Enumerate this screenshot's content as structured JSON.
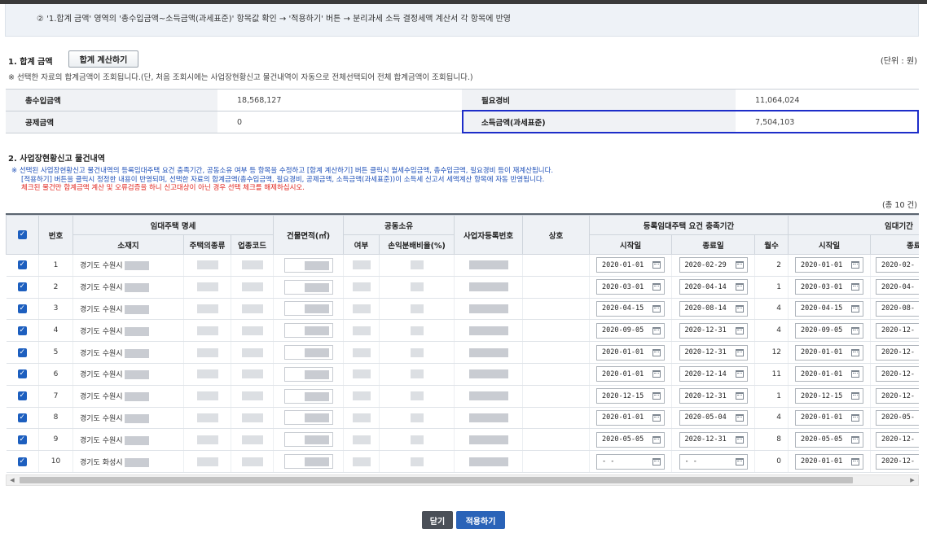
{
  "guide": {
    "text": "② '1.합계 금액' 영역의 '총수입금액~소득금액(과세표준)' 항목값 확인 → '적용하기' 버튼 → 분리과세 소득 결정세액 계산서 각 항목에 반영"
  },
  "section1": {
    "title": "1. 합계 금액",
    "calc_button": "합계 계산하기",
    "unit": "(단위 : 원)",
    "note": "※ 선택한 자료의 합계금액이 조회됩니다.(단, 처음 조회시에는 사업장현황신고 물건내역이 자동으로 전체선택되어 전체 합계금액이 조회됩니다.)",
    "total_income_label": "총수입금액",
    "total_income_value": "18,568,127",
    "expense_label": "필요경비",
    "expense_value": "11,064,024",
    "deduction_label": "공제금액",
    "deduction_value": "0",
    "taxable_label": "소득금액(과세표준)",
    "taxable_value": "7,504,103"
  },
  "section2": {
    "title": "2. 사업장현황신고 물건내역",
    "note1": "※ 선택된 사업장현황신고 물건내역의 등록임대주택 요건 충족기간, 공동소유 여부 등 항목을 수정하고 [합계 계산하기] 버튼 클릭시 월세수입금액, 총수입금액, 필요경비 등이 재계산됩니다.",
    "note2": "[적용하기] 버튼을 클릭시 정정한 내용이 반영되며, 선택한 자료의 합계금액(총수입금액, 필요경비, 공제금액, 소득금액(과세표준))이 소득세 신고서 세액계산 항목에 자동 반영됩니다.",
    "note3": "체크된 물건만 합계금액 계산 및 오류검증을 하니 신고대상이 아닌 경우 선택 체크를 해제하십시오.",
    "count": "(총 10 건)"
  },
  "table": {
    "headers": {
      "no": "번호",
      "rental_spec": "임대주택 명세",
      "address": "소재지",
      "house_type": "주택의종류",
      "biz_code": "업종코드",
      "area": "건물면적(㎡)",
      "co_own": "공동소유",
      "co_own_yn": "여부",
      "loss_ratio": "손익분배비율(%)",
      "biz_reg_no": "사업자등록번호",
      "trade_name": "상호",
      "req_period": "등록임대주택 요건 충족기간",
      "start_date": "시작일",
      "end_date": "종료일",
      "months": "월수",
      "rent_period": "임대기간",
      "rent_start": "시작일",
      "rent_end": "종료"
    },
    "rows": [
      {
        "no": "1",
        "addr": "경기도 수원시",
        "start": "2020-01-01",
        "end": "2020-02-29",
        "months": "2",
        "rent_start": "2020-01-01",
        "rent_end": "2020-02-"
      },
      {
        "no": "2",
        "addr": "경기도 수원시",
        "start": "2020-03-01",
        "end": "2020-04-14",
        "months": "1",
        "rent_start": "2020-03-01",
        "rent_end": "2020-04-"
      },
      {
        "no": "3",
        "addr": "경기도 수원시",
        "start": "2020-04-15",
        "end": "2020-08-14",
        "months": "4",
        "rent_start": "2020-04-15",
        "rent_end": "2020-08-"
      },
      {
        "no": "4",
        "addr": "경기도 수원시",
        "start": "2020-09-05",
        "end": "2020-12-31",
        "months": "4",
        "rent_start": "2020-09-05",
        "rent_end": "2020-12-"
      },
      {
        "no": "5",
        "addr": "경기도 수원시",
        "start": "2020-01-01",
        "end": "2020-12-31",
        "months": "12",
        "rent_start": "2020-01-01",
        "rent_end": "2020-12-"
      },
      {
        "no": "6",
        "addr": "경기도 수원시",
        "start": "2020-01-01",
        "end": "2020-12-14",
        "months": "11",
        "rent_start": "2020-01-01",
        "rent_end": "2020-12-"
      },
      {
        "no": "7",
        "addr": "경기도 수원시",
        "start": "2020-12-15",
        "end": "2020-12-31",
        "months": "1",
        "rent_start": "2020-12-15",
        "rent_end": "2020-12-"
      },
      {
        "no": "8",
        "addr": "경기도 수원시",
        "start": "2020-01-01",
        "end": "2020-05-04",
        "months": "4",
        "rent_start": "2020-01-01",
        "rent_end": "2020-05-"
      },
      {
        "no": "9",
        "addr": "경기도 수원시",
        "start": "2020-05-05",
        "end": "2020-12-31",
        "months": "8",
        "rent_start": "2020-05-05",
        "rent_end": "2020-12-"
      },
      {
        "no": "10",
        "addr": "경기도 화성시",
        "start": "- -",
        "end": "- -",
        "months": "0",
        "rent_start": "2020-01-01",
        "rent_end": "2020-12-"
      }
    ]
  },
  "footer": {
    "close_label": "닫기",
    "apply_label": "적용하기"
  },
  "colors": {
    "highlight_border": "#1d2dc9",
    "checkbox": "#1d5fbf",
    "apply_button": "#2a63b8",
    "close_button": "#4a4f57",
    "note_blue": "#1d4fb8",
    "note_red": "#e0241d"
  },
  "icons": {
    "checkbox": "checkbox-checked-icon",
    "calendar": "calendar-icon",
    "scroll_left": "scroll-left-arrow-icon",
    "scroll_right": "scroll-right-arrow-icon"
  }
}
